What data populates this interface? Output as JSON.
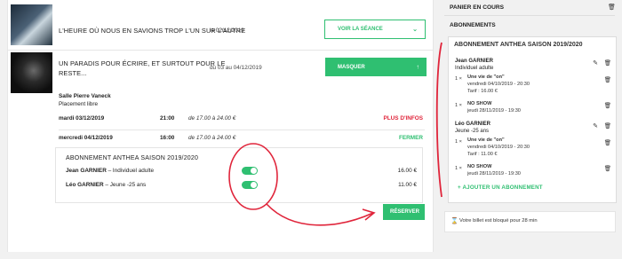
{
  "shows": [
    {
      "title": "L'HEURE OÙ NOUS EN SAVIONS TROP L'UN SUR L'AUTRE",
      "date": "le 02/12/2019",
      "button": "VOIR LA SÉANCE",
      "button_icon": "chevron-down-icon"
    },
    {
      "title_line1": "UN PARADIS POUR ÉCRIRE, ET SURTOUT POUR LE",
      "title_line2": "RESTE...",
      "date": "du 03 au 04/12/2019",
      "button": "MASQUER",
      "button_icon": "chevron-up-icon"
    }
  ],
  "venue": {
    "name": "Salle Pierre Vaneck",
    "placement": "Placement libre"
  },
  "performances": [
    {
      "date": "mardi 03/12/2019",
      "time": "21:00",
      "price": "de 17.00 à 24.00 €",
      "action": "PLUS D'INFOS",
      "action_color": "#e0253b"
    },
    {
      "date": "mercredi 04/12/2019",
      "time": "16:00",
      "price": "de 17.00 à 24.00 €",
      "action": "FERMER",
      "action_color": "#2fbf71"
    }
  ],
  "subscription_box": {
    "title": "ABONNEMENT ANTHEA SAISON 2019/2020",
    "lines": [
      {
        "name": "Jean GARNIER",
        "category": " – Individuel adulte",
        "price": "16.00 €",
        "toggle_on": true
      },
      {
        "name": "Léo GARNIER",
        "category": " – Jeune -25 ans",
        "price": "11.00 €",
        "toggle_on": true
      }
    ]
  },
  "reserve_button": "RÉSERVER",
  "sidebar": {
    "cart_title": "PANIER EN COURS",
    "subscriptions_title": "ABONNEMENTS",
    "box_title": "ABONNEMENT ANTHEA SAISON 2019/2020",
    "holders": [
      {
        "name": "Jean GARNIER",
        "category": "Individuel adulte",
        "items": [
          {
            "qty": "1 ×",
            "title": "Une vie de \"on\"",
            "when": "vendredi 04/10/2019 - 20:30",
            "tarif": "Tarif : 16.00 €"
          },
          {
            "qty": "1 ×",
            "title": "NO SHOW",
            "when": "jeudi 28/11/2019 - 19:30"
          }
        ]
      },
      {
        "name": "Léo GARNIER",
        "category": "Jeune -25 ans",
        "items": [
          {
            "qty": "1 ×",
            "title": "Une vie de \"on\"",
            "when": "vendredi 04/10/2019 - 20:30",
            "tarif": "Tarif : 11.00 €"
          },
          {
            "qty": "1 ×",
            "title": "NO SHOW",
            "when": "jeudi 28/11/2019 - 19:30"
          }
        ]
      }
    ],
    "add_subscription": "AJOUTER UN ABONNEMENT",
    "notice": "Votre billet est bloqué pour 28 min"
  },
  "colors": {
    "accent": "#2fbf71",
    "alert": "#e0253b",
    "annotation": "#e0253b"
  }
}
